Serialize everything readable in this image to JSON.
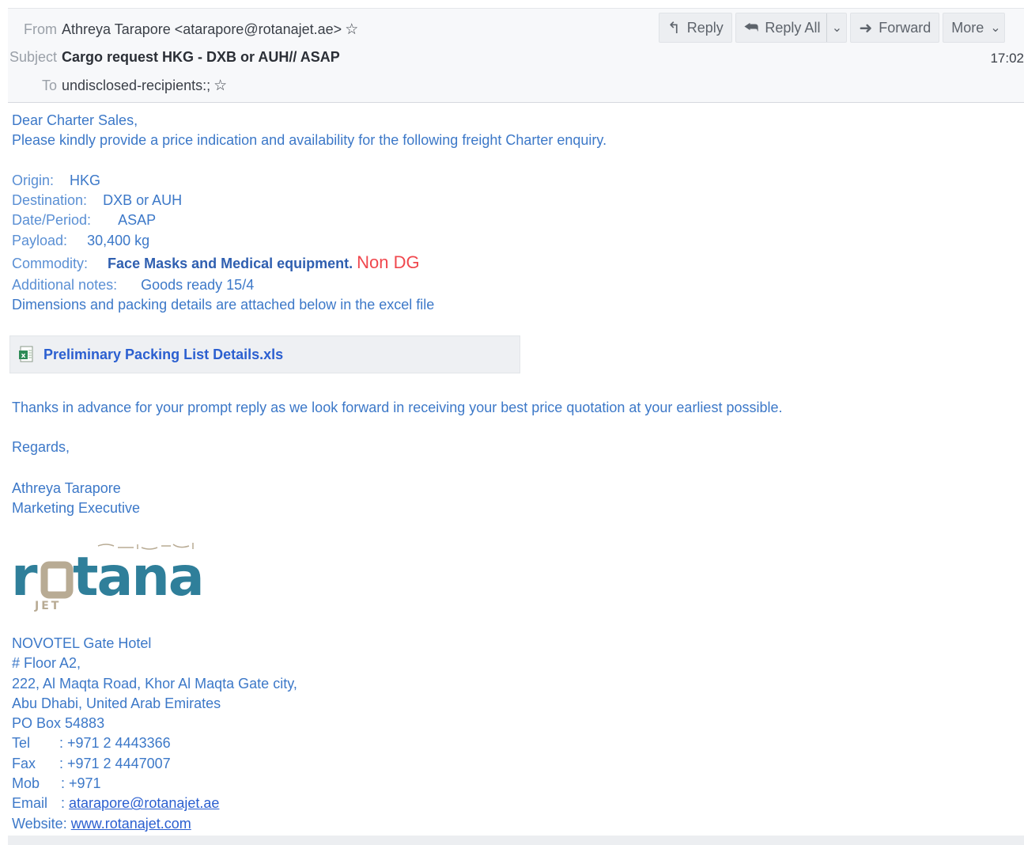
{
  "header": {
    "from_label": "From",
    "from_value": "Athreya Tarapore <atarapore@rotanajet.ae>",
    "subject_label": "Subject",
    "subject_value": "Cargo request HKG - DXB or AUH// ASAP",
    "to_label": "To",
    "to_value": "undisclosed-recipients:;",
    "time": "17:02",
    "star_icon": "star-outline-icon"
  },
  "toolbar": {
    "reply": "Reply",
    "reply_all": "Reply All",
    "forward": "Forward",
    "more": "More"
  },
  "body": {
    "greeting": "Dear Charter Sales,",
    "intro": "Please kindly provide a price indication and availability for the following freight Charter enquiry.",
    "origin_key": "Origin:",
    "origin_val": "HKG",
    "destination_key": "Destination:",
    "destination_val": "DXB or AUH",
    "date_key": "Date/Period:",
    "date_val": "ASAP",
    "payload_key": "Payload:",
    "payload_val": "30,400 kg",
    "commodity_key": "Commodity:",
    "commodity_val": "Face Masks and Medical equipment.",
    "commodity_flag": "Non DG",
    "notes_key": "Additional notes:",
    "notes_val": "Goods ready 15/4",
    "dimensions": "Dimensions and packing details are attached below in the excel file"
  },
  "attachment": {
    "name": "Preliminary Packing List Details.xls",
    "icon": "excel-file-icon"
  },
  "closing": {
    "thanks": "Thanks in advance for your prompt reply as we look forward in receiving your best price quotation at your earliest possible.",
    "regards": "Regards,"
  },
  "signature": {
    "name": "Athreya Tarapore",
    "title": "Marketing Executive",
    "logo_text": "rotana",
    "logo_sub": "JET",
    "address": [
      "NOVOTEL Gate Hotel",
      "# Floor A2,",
      "222, Al Maqta Road, Khor Al Maqta Gate city,",
      "Abu Dhabi, United Arab Emirates",
      "PO  Box 54883"
    ],
    "tel_key": "Tel",
    "tel_val": ": +971 2 4443366",
    "fax_key": "Fax",
    "fax_val": ": +971 2 4447007",
    "mob_key": "Mob",
    "mob_val": ": +971",
    "email_key": "Email",
    "email_sep": ":",
    "email_val": "atarapore@rotanajet.ae",
    "website_key": "Website:",
    "website_val": "www.rotanajet.com"
  },
  "colors": {
    "body_text": "#3c78c8",
    "accent_red": "#f0484e",
    "link": "#2b5fd0",
    "logo_teal": "#2f7f9a",
    "logo_sand": "#b8ab94"
  }
}
